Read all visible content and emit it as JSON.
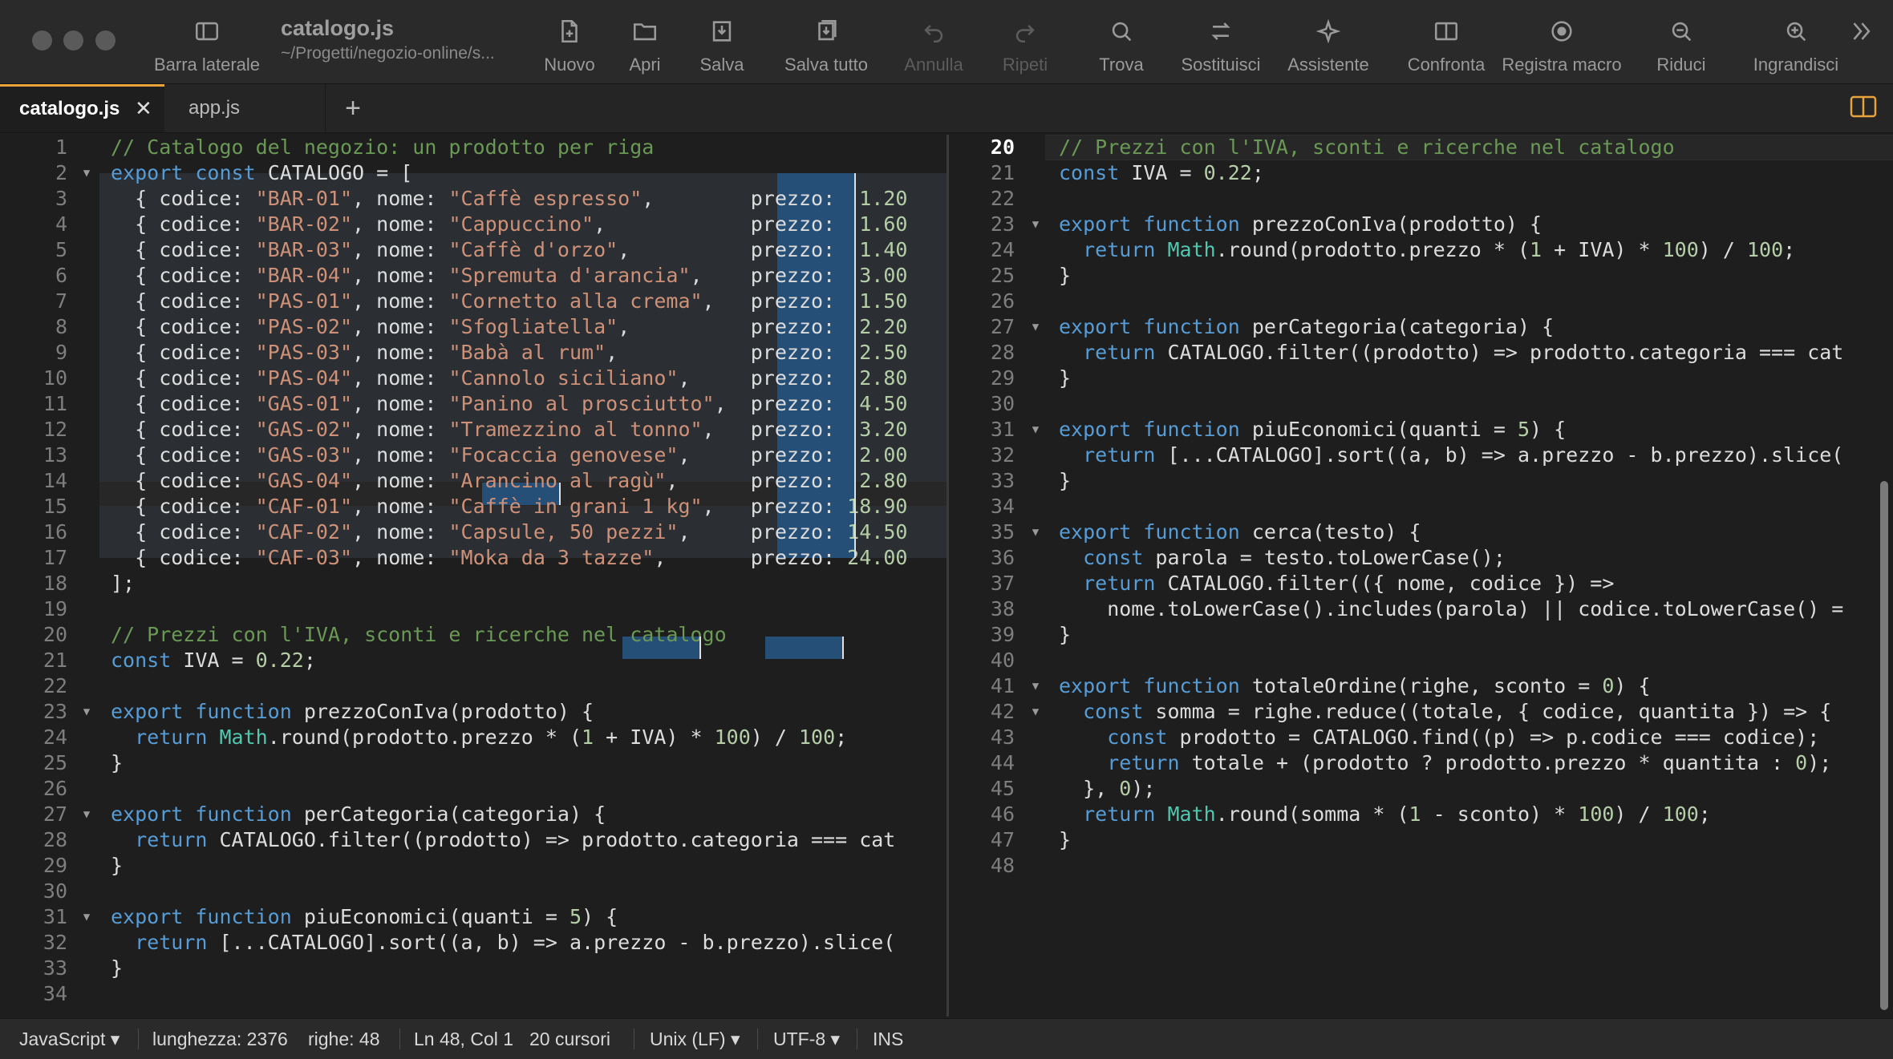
{
  "toolbar": {
    "sidebar_label": "Barra laterale",
    "doc_title": "catalogo.js",
    "doc_path": "~/Progetti/negozio-online/s...",
    "buttons": [
      {
        "label": "Nuovo",
        "icon": "new-file-icon",
        "enabled": true
      },
      {
        "label": "Apri",
        "icon": "folder-icon",
        "enabled": true
      },
      {
        "label": "Salva",
        "icon": "save-icon",
        "enabled": true
      },
      {
        "label": "Salva tutto",
        "icon": "save-all-icon",
        "enabled": true
      },
      {
        "label": "Annulla",
        "icon": "undo-icon",
        "enabled": false
      },
      {
        "label": "Ripeti",
        "icon": "redo-icon",
        "enabled": false
      },
      {
        "label": "Trova",
        "icon": "search-icon",
        "enabled": true
      },
      {
        "label": "Sostituisci",
        "icon": "replace-icon",
        "enabled": true
      },
      {
        "label": "Assistente",
        "icon": "sparkle-icon",
        "enabled": true
      },
      {
        "label": "Confronta",
        "icon": "compare-icon",
        "enabled": true
      },
      {
        "label": "Registra macro",
        "icon": "record-icon",
        "enabled": true
      },
      {
        "label": "Riduci",
        "icon": "zoom-out-icon",
        "enabled": true
      },
      {
        "label": "Ingrandisci",
        "icon": "zoom-in-icon",
        "enabled": true
      }
    ],
    "overflow_icon": "chevron-double-right-icon"
  },
  "tabs": [
    {
      "label": "catalogo.js",
      "active": true,
      "close": "✕"
    },
    {
      "label": "app.js",
      "active": false
    }
  ],
  "tab_add": "+",
  "left_editor": {
    "first_line": 1,
    "lines": [
      [
        [
          "cm",
          "// Catalogo del negozio: un prodotto per riga"
        ]
      ],
      [
        [
          "kw",
          "export"
        ],
        [
          "pl",
          " "
        ],
        [
          "kw",
          "const"
        ],
        [
          "pl",
          " CATALOGO = ["
        ]
      ],
      [
        [
          "pl",
          "  { codice: "
        ],
        [
          "st",
          "\"BAR-01\""
        ],
        [
          "pl",
          ", nome: "
        ],
        [
          "st",
          "\"Caffè espresso\""
        ],
        [
          "pl",
          ",        prezzo:  "
        ],
        [
          "nm",
          "1.20"
        ]
      ],
      [
        [
          "pl",
          "  { codice: "
        ],
        [
          "st",
          "\"BAR-02\""
        ],
        [
          "pl",
          ", nome: "
        ],
        [
          "st",
          "\"Cappuccino\""
        ],
        [
          "pl",
          ",            prezzo:  "
        ],
        [
          "nm",
          "1.60"
        ]
      ],
      [
        [
          "pl",
          "  { codice: "
        ],
        [
          "st",
          "\"BAR-03\""
        ],
        [
          "pl",
          ", nome: "
        ],
        [
          "st",
          "\"Caffè d'orzo\""
        ],
        [
          "pl",
          ",          prezzo:  "
        ],
        [
          "nm",
          "1.40"
        ]
      ],
      [
        [
          "pl",
          "  { codice: "
        ],
        [
          "st",
          "\"BAR-04\""
        ],
        [
          "pl",
          ", nome: "
        ],
        [
          "st",
          "\"Spremuta d'arancia\""
        ],
        [
          "pl",
          ",    prezzo:  "
        ],
        [
          "nm",
          "3.00"
        ]
      ],
      [
        [
          "pl",
          "  { codice: "
        ],
        [
          "st",
          "\"PAS-01\""
        ],
        [
          "pl",
          ", nome: "
        ],
        [
          "st",
          "\"Cornetto alla crema\""
        ],
        [
          "pl",
          ",   prezzo:  "
        ],
        [
          "nm",
          "1.50"
        ]
      ],
      [
        [
          "pl",
          "  { codice: "
        ],
        [
          "st",
          "\"PAS-02\""
        ],
        [
          "pl",
          ", nome: "
        ],
        [
          "st",
          "\"Sfogliatella\""
        ],
        [
          "pl",
          ",          prezzo:  "
        ],
        [
          "nm",
          "2.20"
        ]
      ],
      [
        [
          "pl",
          "  { codice: "
        ],
        [
          "st",
          "\"PAS-03\""
        ],
        [
          "pl",
          ", nome: "
        ],
        [
          "st",
          "\"Babà al rum\""
        ],
        [
          "pl",
          ",           prezzo:  "
        ],
        [
          "nm",
          "2.50"
        ]
      ],
      [
        [
          "pl",
          "  { codice: "
        ],
        [
          "st",
          "\"PAS-04\""
        ],
        [
          "pl",
          ", nome: "
        ],
        [
          "st",
          "\"Cannolo siciliano\""
        ],
        [
          "pl",
          ",     prezzo:  "
        ],
        [
          "nm",
          "2.80"
        ]
      ],
      [
        [
          "pl",
          "  { codice: "
        ],
        [
          "st",
          "\"GAS-01\""
        ],
        [
          "pl",
          ", nome: "
        ],
        [
          "st",
          "\"Panino al prosciutto\""
        ],
        [
          "pl",
          ",  prezzo:  "
        ],
        [
          "nm",
          "4.50"
        ]
      ],
      [
        [
          "pl",
          "  { codice: "
        ],
        [
          "st",
          "\"GAS-02\""
        ],
        [
          "pl",
          ", nome: "
        ],
        [
          "st",
          "\"Tramezzino al tonno\""
        ],
        [
          "pl",
          ",   prezzo:  "
        ],
        [
          "nm",
          "3.20"
        ]
      ],
      [
        [
          "pl",
          "  { codice: "
        ],
        [
          "st",
          "\"GAS-03\""
        ],
        [
          "pl",
          ", nome: "
        ],
        [
          "st",
          "\"Focaccia genovese\""
        ],
        [
          "pl",
          ",     prezzo:  "
        ],
        [
          "nm",
          "2.00"
        ]
      ],
      [
        [
          "pl",
          "  { codice: "
        ],
        [
          "st",
          "\"GAS-04\""
        ],
        [
          "pl",
          ", nome: "
        ],
        [
          "st",
          "\"Arancino al ragù\""
        ],
        [
          "pl",
          ",      prezzo:  "
        ],
        [
          "nm",
          "2.80"
        ]
      ],
      [
        [
          "pl",
          "  { codice: "
        ],
        [
          "st",
          "\"CAF-01\""
        ],
        [
          "pl",
          ", nome: "
        ],
        [
          "st",
          "\"Caffè in grani 1 kg\""
        ],
        [
          "pl",
          ",   prezzo: "
        ],
        [
          "nm",
          "18.90"
        ]
      ],
      [
        [
          "pl",
          "  { codice: "
        ],
        [
          "st",
          "\"CAF-02\""
        ],
        [
          "pl",
          ", nome: "
        ],
        [
          "st",
          "\"Capsule, 50 pezzi\""
        ],
        [
          "pl",
          ",     prezzo: "
        ],
        [
          "nm",
          "14.50"
        ]
      ],
      [
        [
          "pl",
          "  { codice: "
        ],
        [
          "st",
          "\"CAF-03\""
        ],
        [
          "pl",
          ", nome: "
        ],
        [
          "st",
          "\"Moka da 3 tazze\""
        ],
        [
          "pl",
          ",       prezzo: "
        ],
        [
          "nm",
          "24.00"
        ]
      ],
      [
        [
          "pl",
          "];"
        ]
      ],
      [],
      [
        [
          "cm",
          "// Prezzi con l'IVA, sconti e ricerche nel catalogo"
        ]
      ],
      [
        [
          "kw",
          "const"
        ],
        [
          "pl",
          " IVA = "
        ],
        [
          "nm",
          "0.22"
        ],
        [
          "pl",
          ";"
        ]
      ],
      [],
      [
        [
          "kw",
          "export"
        ],
        [
          "pl",
          " "
        ],
        [
          "kw",
          "function"
        ],
        [
          "pl",
          " prezzoConIva(prodotto) {"
        ]
      ],
      [
        [
          "pl",
          "  "
        ],
        [
          "kw",
          "return"
        ],
        [
          "pl",
          " "
        ],
        [
          "cl",
          "Math"
        ],
        [
          "pl",
          ".round(prodotto.prezzo * ("
        ],
        [
          "nm",
          "1"
        ],
        [
          "pl",
          " + IVA) * "
        ],
        [
          "nm",
          "100"
        ],
        [
          "pl",
          ") / "
        ],
        [
          "nm",
          "100"
        ],
        [
          "pl",
          ";"
        ]
      ],
      [
        [
          "pl",
          "}"
        ]
      ],
      [],
      [
        [
          "kw",
          "export"
        ],
        [
          "pl",
          " "
        ],
        [
          "kw",
          "function"
        ],
        [
          "pl",
          " perCategoria(categoria) {"
        ]
      ],
      [
        [
          "pl",
          "  "
        ],
        [
          "kw",
          "return"
        ],
        [
          "pl",
          " CATALOGO.filter((prodotto) => prodotto.categoria === cat"
        ]
      ],
      [
        [
          "pl",
          "}"
        ]
      ],
      [],
      [
        [
          "kw",
          "export"
        ],
        [
          "pl",
          " "
        ],
        [
          "kw",
          "function"
        ],
        [
          "pl",
          " piuEconomici(quanti = "
        ],
        [
          "nm",
          "5"
        ],
        [
          "pl",
          ") {"
        ]
      ],
      [
        [
          "pl",
          "  "
        ],
        [
          "kw",
          "return"
        ],
        [
          "pl",
          " [...CATALOGO].sort((a, b) => a.prezzo - b.prezzo).slice("
        ]
      ],
      [
        [
          "pl",
          "}"
        ]
      ],
      []
    ],
    "fold_lines": [
      2,
      23,
      27,
      31
    ],
    "fold_glyph": "▼"
  },
  "right_editor": {
    "first_line": 20,
    "current_line": 20,
    "lines": [
      [
        [
          "cm",
          "// Prezzi con l'IVA, sconti e ricerche nel catalogo"
        ]
      ],
      [
        [
          "kw",
          "const"
        ],
        [
          "pl",
          " IVA = "
        ],
        [
          "nm",
          "0.22"
        ],
        [
          "pl",
          ";"
        ]
      ],
      [],
      [
        [
          "kw",
          "export"
        ],
        [
          "pl",
          " "
        ],
        [
          "kw",
          "function"
        ],
        [
          "pl",
          " prezzoConIva(prodotto) {"
        ]
      ],
      [
        [
          "pl",
          "  "
        ],
        [
          "kw",
          "return"
        ],
        [
          "pl",
          " "
        ],
        [
          "cl",
          "Math"
        ],
        [
          "pl",
          ".round(prodotto.prezzo * ("
        ],
        [
          "nm",
          "1"
        ],
        [
          "pl",
          " + IVA) * "
        ],
        [
          "nm",
          "100"
        ],
        [
          "pl",
          ") / "
        ],
        [
          "nm",
          "100"
        ],
        [
          "pl",
          ";"
        ]
      ],
      [
        [
          "pl",
          "}"
        ]
      ],
      [],
      [
        [
          "kw",
          "export"
        ],
        [
          "pl",
          " "
        ],
        [
          "kw",
          "function"
        ],
        [
          "pl",
          " perCategoria(categoria) {"
        ]
      ],
      [
        [
          "pl",
          "  "
        ],
        [
          "kw",
          "return"
        ],
        [
          "pl",
          " CATALOGO.filter((prodotto) => prodotto.categoria === cat"
        ]
      ],
      [
        [
          "pl",
          "}"
        ]
      ],
      [],
      [
        [
          "kw",
          "export"
        ],
        [
          "pl",
          " "
        ],
        [
          "kw",
          "function"
        ],
        [
          "pl",
          " piuEconomici(quanti = "
        ],
        [
          "nm",
          "5"
        ],
        [
          "pl",
          ") {"
        ]
      ],
      [
        [
          "pl",
          "  "
        ],
        [
          "kw",
          "return"
        ],
        [
          "pl",
          " [...CATALOGO].sort((a, b) => a.prezzo - b.prezzo).slice("
        ]
      ],
      [
        [
          "pl",
          "}"
        ]
      ],
      [],
      [
        [
          "kw",
          "export"
        ],
        [
          "pl",
          " "
        ],
        [
          "kw",
          "function"
        ],
        [
          "pl",
          " cerca(testo) {"
        ]
      ],
      [
        [
          "pl",
          "  "
        ],
        [
          "kw",
          "const"
        ],
        [
          "pl",
          " parola = testo.toLowerCase();"
        ]
      ],
      [
        [
          "pl",
          "  "
        ],
        [
          "kw",
          "return"
        ],
        [
          "pl",
          " CATALOGO.filter(({ nome, codice }) =>"
        ]
      ],
      [
        [
          "pl",
          "    nome.toLowerCase().includes(parola) || codice.toLowerCase() ="
        ]
      ],
      [
        [
          "pl",
          "}"
        ]
      ],
      [],
      [
        [
          "kw",
          "export"
        ],
        [
          "pl",
          " "
        ],
        [
          "kw",
          "function"
        ],
        [
          "pl",
          " totaleOrdine(righe, sconto = "
        ],
        [
          "nm",
          "0"
        ],
        [
          "pl",
          ") {"
        ]
      ],
      [
        [
          "pl",
          "  "
        ],
        [
          "kw",
          "const"
        ],
        [
          "pl",
          " somma = righe.reduce((totale, { codice, quantita }) => {"
        ]
      ],
      [
        [
          "pl",
          "    "
        ],
        [
          "kw",
          "const"
        ],
        [
          "pl",
          " prodotto = CATALOGO.find((p) => p.codice === codice);"
        ]
      ],
      [
        [
          "pl",
          "    "
        ],
        [
          "kw",
          "return"
        ],
        [
          "pl",
          " totale + (prodotto ? prodotto.prezzo * quantita : "
        ],
        [
          "nm",
          "0"
        ],
        [
          "pl",
          ");"
        ]
      ],
      [
        [
          "pl",
          "  }, "
        ],
        [
          "nm",
          "0"
        ],
        [
          "pl",
          ");"
        ]
      ],
      [
        [
          "pl",
          "  "
        ],
        [
          "kw",
          "return"
        ],
        [
          "pl",
          " "
        ],
        [
          "cl",
          "Math"
        ],
        [
          "pl",
          ".round(somma * ("
        ],
        [
          "nm",
          "1"
        ],
        [
          "pl",
          " - sconto) * "
        ],
        [
          "nm",
          "100"
        ],
        [
          "pl",
          ") / "
        ],
        [
          "nm",
          "100"
        ],
        [
          "pl",
          ";"
        ]
      ],
      [
        [
          "pl",
          "}"
        ]
      ],
      []
    ],
    "fold_lines": [
      23,
      27,
      31,
      35,
      41,
      42
    ],
    "fold_glyph": "▼"
  },
  "statusbar": {
    "language": "JavaScript ▾",
    "length": "lunghezza: 2376",
    "lines": "righe: 48",
    "position": "Ln 48, Col 1",
    "cursors": "20 cursori",
    "line_ending": "Unix (LF) ▾",
    "encoding": "UTF-8 ▾",
    "mode": "INS"
  },
  "colors": {
    "accent_tab": "#e8a33a",
    "keyword": "#569cd6",
    "string": "#ce9178",
    "number": "#b5cea8",
    "comment": "#6a9955",
    "class": "#4ec9b0",
    "selection": "#264f78"
  }
}
